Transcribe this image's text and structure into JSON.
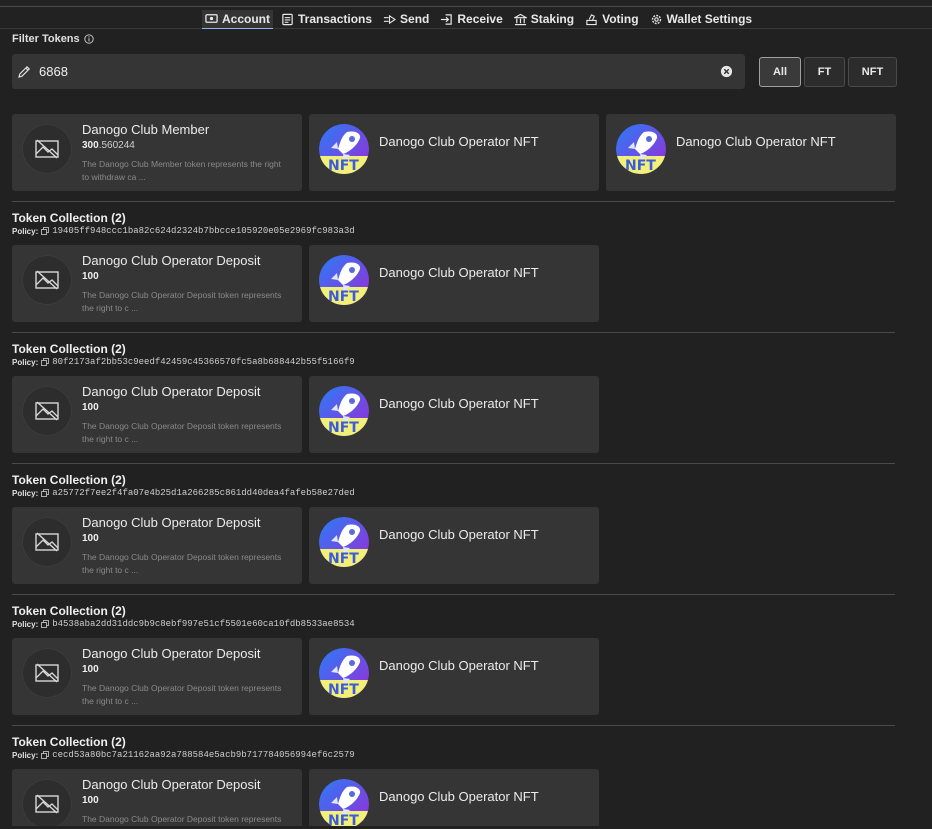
{
  "tabs": [
    {
      "label": "Account",
      "icon": "wallet-icon",
      "active": true
    },
    {
      "label": "Transactions",
      "icon": "receipt-icon"
    },
    {
      "label": "Send",
      "icon": "send-icon"
    },
    {
      "label": "Receive",
      "icon": "receive-icon"
    },
    {
      "label": "Staking",
      "icon": "bank-icon"
    },
    {
      "label": "Voting",
      "icon": "vote-icon"
    },
    {
      "label": "Wallet Settings",
      "icon": "gear-icon"
    }
  ],
  "filter": {
    "label": "Filter Tokens",
    "value": "6868",
    "buttons": [
      {
        "label": "All",
        "active": true
      },
      {
        "label": "FT"
      },
      {
        "label": "NFT"
      }
    ]
  },
  "ungrouped": [
    {
      "kind": "ft",
      "title": "Danogo Club Member",
      "amount_int": "300",
      "amount_dec": ".560244",
      "desc": "The Danogo Club Member token represents the right to withdraw ca ..."
    },
    {
      "kind": "nft",
      "title": "Danogo Club Operator NFT"
    },
    {
      "kind": "nft",
      "title": "Danogo Club Operator NFT"
    }
  ],
  "policy_label": "Policy:",
  "collections": [
    {
      "title": "Token Collection (2)",
      "policy": "19405ff948ccc1ba82c624d2324b7bbcce105920e05e2969fc983a3d",
      "ft": {
        "title": "Danogo Club Operator Deposit",
        "amount": "100",
        "desc": "The Danogo Club Operator Deposit token represents the right to c ..."
      },
      "nft": {
        "title": "Danogo Club Operator NFT"
      }
    },
    {
      "title": "Token Collection (2)",
      "policy": "80f2173af2bb53c9eedf42459c45366570fc5a8b688442b55f5166f9",
      "ft": {
        "title": "Danogo Club Operator Deposit",
        "amount": "100",
        "desc": "The Danogo Club Operator Deposit token represents the right to c ..."
      },
      "nft": {
        "title": "Danogo Club Operator NFT"
      }
    },
    {
      "title": "Token Collection (2)",
      "policy": "a25772f7ee2f4fa07e4b25d1a266285c861dd40dea4fafeb58e27ded",
      "ft": {
        "title": "Danogo Club Operator Deposit",
        "amount": "100",
        "desc": "The Danogo Club Operator Deposit token represents the right to c ..."
      },
      "nft": {
        "title": "Danogo Club Operator NFT"
      }
    },
    {
      "title": "Token Collection (2)",
      "policy": "b4538aba2dd31ddc9b9c8ebf997e51cf5501e60ca10fdb8533ae8534",
      "ft": {
        "title": "Danogo Club Operator Deposit",
        "amount": "100",
        "desc": "The Danogo Club Operator Deposit token represents the right to c ..."
      },
      "nft": {
        "title": "Danogo Club Operator NFT"
      }
    },
    {
      "title": "Token Collection (2)",
      "policy": "cecd53a80bc7a21162aa92a788584e5acb9b717784056994ef6c2579",
      "ft": {
        "title": "Danogo Club Operator Deposit",
        "amount": "100",
        "desc": "The Danogo Club Operator Deposit token represents the right to c ..."
      },
      "nft": {
        "title": "Danogo Club Operator NFT"
      }
    }
  ],
  "colors": {
    "accent": "#8ab4f8",
    "background": "#212121",
    "card": "#353535"
  }
}
